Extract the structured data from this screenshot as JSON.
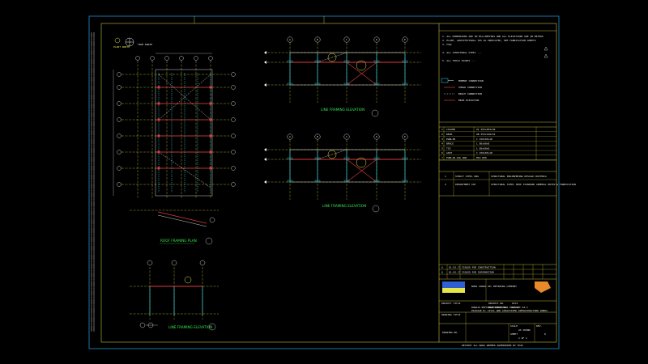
{
  "sheet": {
    "colors": {
      "background": "#000000",
      "frame_outer": "#27a3e0",
      "frame_inner": "#e6e64c",
      "grid": "#e6e64c",
      "beam": "#e03a3a",
      "column": "#3ad6e0",
      "dim": "#ffffff",
      "title_text": "#39e64a",
      "callout": "#e6e64c"
    }
  },
  "plan": {
    "title": "ROOF FRAMING PLAN",
    "north_arrow": "TRUE NORTH",
    "plant_north": "PLANT NORTH"
  },
  "elevation_left": {
    "title": "LINE FRAMING ELEVATION"
  },
  "elevation_top": {
    "title": "LINE FRAMING ELEVATION",
    "grid_labels": [
      "A",
      "B",
      "C",
      "D",
      "E"
    ]
  },
  "elevation_mid": {
    "title": "LINE FRAMING ELEVATION",
    "grid_labels": [
      "A",
      "B",
      "C",
      "D",
      "E"
    ]
  },
  "notes": {
    "items": [
      "1. ALL DIMENSIONS ARE IN MILLIMETERS AND ALL ELEVATIONS ARE IN METERS.",
      "2. PLANT, ARCHITECTURAL TOS AS INDICATED, SEE FABRICATION SHEETS",
      "3. FOR:",
      "4. ALL STRUCTURAL STEEL ...",
      "5. ALL FIELD JOINTS ..."
    ]
  },
  "legend": {
    "items": [
      "MOMENT CONNECTION",
      "SHEAR CONNECTION",
      "BRACE CONNECTION",
      "BEAM ELEVATION"
    ]
  },
  "material_table": {
    "header": [
      "",
      "MEMBER",
      "",
      "SECTION"
    ],
    "rows": [
      [
        "1",
        "COLUMN",
        "",
        "UC 203x203x46"
      ],
      [
        "2",
        "BEAM",
        "",
        "UB 254x146x31"
      ],
      [
        "3",
        "PURLIN",
        "",
        "C 150x65x18"
      ],
      [
        "4",
        "BRACE",
        "",
        "L 80x80x8"
      ],
      [
        "5",
        "TIE",
        "",
        "L 60x60x6"
      ],
      [
        "6",
        "GIRT",
        "",
        "C 150x65x18"
      ],
      [
        "7",
        "PURLIN SAG ROD",
        "",
        "M16 ROD"
      ]
    ]
  },
  "references": {
    "rows": [
      [
        "1",
        "STRUCT STEEL DWG",
        "STRUCTURAL ENGINEERING DESIGN CRITERIA"
      ],
      [
        "2",
        "DEPARTMENT STD",
        "STRUCTURAL STEEL SHOP STANDARD GENERAL NOTES & FABRICATION"
      ]
    ]
  },
  "revisions": {
    "rows": [
      [
        "A",
        "01.03.17",
        "ISSUED FOR CONSTRUCTION"
      ],
      [
        "0",
        "01.05.17",
        "ISSUED FOR INFORMATION"
      ]
    ]
  },
  "title_block": {
    "company": "NORA SHARA OIL REFINING COMPANY",
    "project_no_label": "PROJECT NO.",
    "project_no": "6574",
    "agreement_label": "AGREEMENT NO.",
    "agreement_no": "03-SDT-54-1",
    "project_label": "PROJECT TITLE",
    "project_title": "RUWAIS REFINERY EXPANSION PROJECT",
    "project_subtitle": "PACKAGE B: CIVIL AND ASSOCIATED INFRASTRUCTURE WORKS",
    "drawing_title_label": "DRAWING TITLE",
    "drawing_no_label": "DRAWING NO.",
    "scale_label": "SCALE",
    "scale": "AS SHOWN",
    "sheet_label": "SHEET",
    "sheet": "1 OF 1",
    "rev_label": "REV.",
    "rev": "0",
    "footer": "DESTROY ALL DWGS DEEMED SUPERSEDED BY THIS"
  }
}
